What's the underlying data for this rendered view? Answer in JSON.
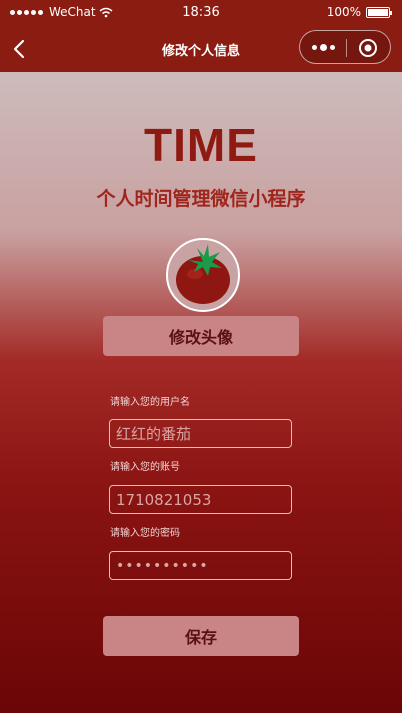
{
  "status_bar": {
    "carrier": "WeChat",
    "time": "18:36",
    "battery": "100%"
  },
  "nav": {
    "title": "修改个人信息"
  },
  "brand": {
    "title": "TIME",
    "subtitle": "个人时间管理微信小程序"
  },
  "avatar": {
    "icon": "tomato-icon"
  },
  "buttons": {
    "change_avatar": "修改头像",
    "save": "保存"
  },
  "form": {
    "username": {
      "label": "请输入您的用户名",
      "value": "红红的番茄"
    },
    "account": {
      "label": "请输入您的账号",
      "value": "1710821053"
    },
    "password": {
      "label": "请输入您的密码",
      "value": "••••••••••"
    }
  },
  "colors": {
    "nav_bg": "#8b1c12",
    "accent": "#8e1a12",
    "button_bg": "#c98485"
  }
}
